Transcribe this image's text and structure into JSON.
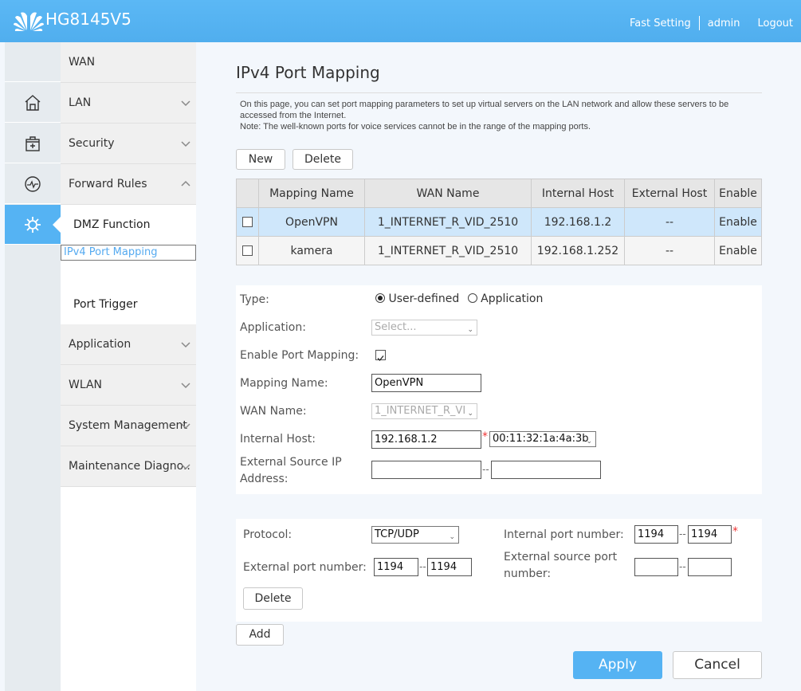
{
  "header": {
    "brand": "HG8145V5",
    "links": {
      "fast_setting": "Fast Setting",
      "user": "admin",
      "logout": "Logout"
    }
  },
  "sidebar": {
    "icons": [
      "home-icon",
      "toolbox-icon",
      "monitor-icon",
      "gear-icon"
    ],
    "menu": [
      {
        "label": "WAN",
        "expandable": false
      },
      {
        "label": "LAN",
        "expandable": true
      },
      {
        "label": "Security",
        "expandable": true
      },
      {
        "label": "Forward Rules",
        "expandable": true,
        "expanded": true
      }
    ],
    "submenu": [
      {
        "label": "DMZ Function"
      },
      {
        "label": "IPv4 Port Mapping",
        "selected": true
      },
      {
        "label": "Port Trigger"
      }
    ],
    "menu2": [
      {
        "label": "Application"
      },
      {
        "label": "WLAN"
      },
      {
        "label": "System Management"
      },
      {
        "label": "Maintenance Diagno.."
      }
    ]
  },
  "page": {
    "title": "IPv4 Port Mapping",
    "desc1": "On this page, you can set port mapping parameters to set up virtual servers on the LAN network and allow these servers to be accessed from the Internet.",
    "desc2": "Note: The well-known ports for voice services cannot be in the range of the mapping ports.",
    "new_label": "New",
    "delete_label": "Delete"
  },
  "table": {
    "headers": [
      "",
      "Mapping Name",
      "WAN Name",
      "Internal Host",
      "External Host",
      "Enable"
    ],
    "rows": [
      {
        "name": "OpenVPN",
        "wan": "1_INTERNET_R_VID_2510",
        "internal": "192.168.1.2",
        "external": "--",
        "enable": "Enable",
        "checked": false
      },
      {
        "name": "kamera",
        "wan": "1_INTERNET_R_VID_2510",
        "internal": "192.168.1.252",
        "external": "--",
        "enable": "Enable",
        "checked": false
      }
    ]
  },
  "form": {
    "type_label": "Type:",
    "type_options": [
      "User-defined",
      "Application"
    ],
    "type_selected": "User-defined",
    "application_label": "Application:",
    "application_value": "Select...",
    "enable_label": "Enable Port Mapping:",
    "enable_checked": true,
    "mapping_name_label": "Mapping Name:",
    "mapping_name_value": "OpenVPN",
    "wan_name_label": "WAN Name:",
    "wan_name_value": "1_INTERNET_R_VI",
    "internal_host_label": "Internal Host:",
    "internal_host_value": "192.168.1.2",
    "internal_host_mac": "00:11:32:1a:4a:3b",
    "ext_src_ip_label_1": "External Source IP",
    "ext_src_ip_label_2": "Address:",
    "ext_src_ip_start": "",
    "ext_src_ip_end": "",
    "dash": "--",
    "required": "*"
  },
  "ports": {
    "protocol_label": "Protocol:",
    "protocol_value": "TCP/UDP",
    "internal_port_label": "Internal port number:",
    "internal_port_start": "1194",
    "internal_port_end": "1194",
    "external_port_label": "External port number:",
    "external_port_start": "1194",
    "external_port_end": "1194",
    "ext_src_port_label_1": "External source port",
    "ext_src_port_label_2": "number:",
    "ext_src_port_start": "",
    "ext_src_port_end": "",
    "delete_label": "Delete"
  },
  "actions": {
    "add_label": "Add",
    "apply_label": "Apply",
    "cancel_label": "Cancel"
  }
}
